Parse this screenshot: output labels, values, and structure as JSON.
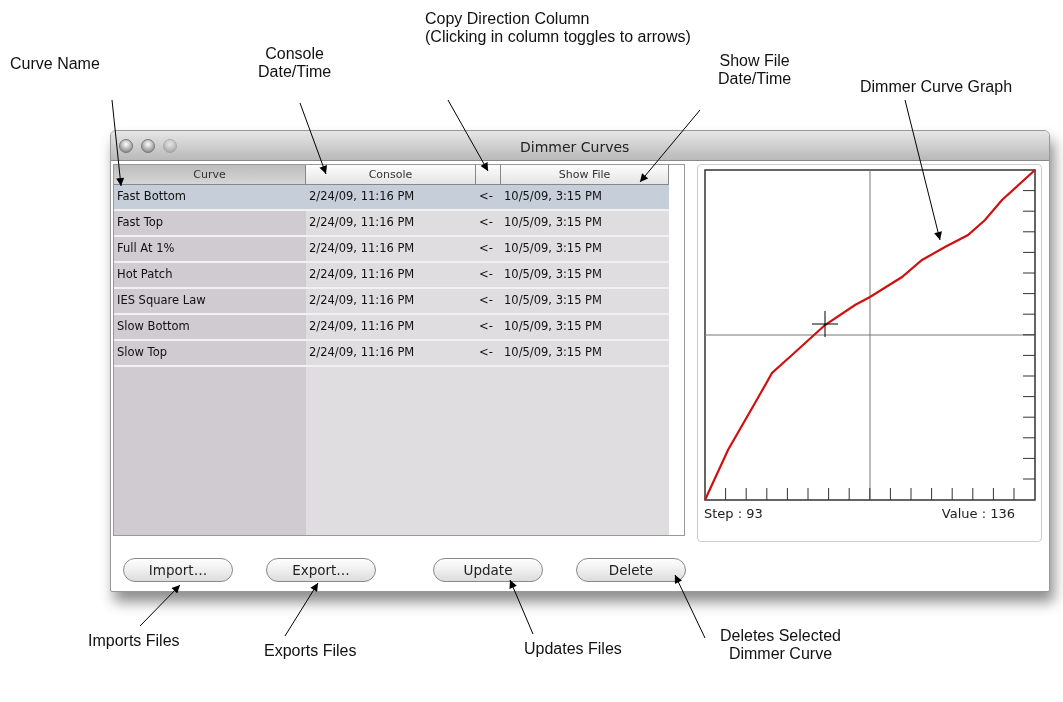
{
  "annotations": [
    {
      "text": "Curve Name"
    },
    {
      "text": "Console\nDate/Time"
    },
    {
      "text": "Copy Direction Column\n(Clicking in column toggles to arrows)"
    },
    {
      "text": "Show File\nDate/Time"
    },
    {
      "text": "Dimmer Curve Graph"
    },
    {
      "text": "Imports Files"
    },
    {
      "text": "Exports Files"
    },
    {
      "text": "Updates Files"
    },
    {
      "text": "Deletes Selected\nDimmer Curve"
    }
  ],
  "window": {
    "title": "Dimmer Curves"
  },
  "table": {
    "columns": [
      {
        "label": "Curve",
        "selected": true
      },
      {
        "label": "Console",
        "selected": false
      },
      {
        "selected": false
      },
      {
        "label": "Show File",
        "selected": false
      }
    ],
    "rows": [
      {
        "name": "Fast Bottom",
        "console": "2/24/09, 11:16 PM",
        "direction": "<-",
        "show_file": "10/5/09, 3:15 PM",
        "selected": true
      },
      {
        "name": "Fast Top",
        "console": "2/24/09, 11:16 PM",
        "direction": "<-",
        "show_file": "10/5/09, 3:15 PM",
        "selected": false
      },
      {
        "name": "Full At 1%",
        "console": "2/24/09, 11:16 PM",
        "direction": "<-",
        "show_file": "10/5/09, 3:15 PM",
        "selected": false
      },
      {
        "name": "Hot Patch",
        "console": "2/24/09, 11:16 PM",
        "direction": "<-",
        "show_file": "10/5/09, 3:15 PM",
        "selected": false
      },
      {
        "name": "IES Square Law",
        "console": "2/24/09, 11:16 PM",
        "direction": "<-",
        "show_file": "10/5/09, 3:15 PM",
        "selected": false
      },
      {
        "name": "Slow Bottom",
        "console": "2/24/09, 11:16 PM",
        "direction": "<-",
        "show_file": "10/5/09, 3:15 PM",
        "selected": false
      },
      {
        "name": "Slow Top",
        "console": "2/24/09, 11:16 PM",
        "direction": "<-",
        "show_file": "10/5/09, 3:15 PM",
        "selected": false
      }
    ]
  },
  "graph": {
    "step": "Step : 93",
    "value": "Value : 136"
  },
  "buttons": [
    "Import…",
    "Export…",
    "Update",
    "Delete"
  ]
}
